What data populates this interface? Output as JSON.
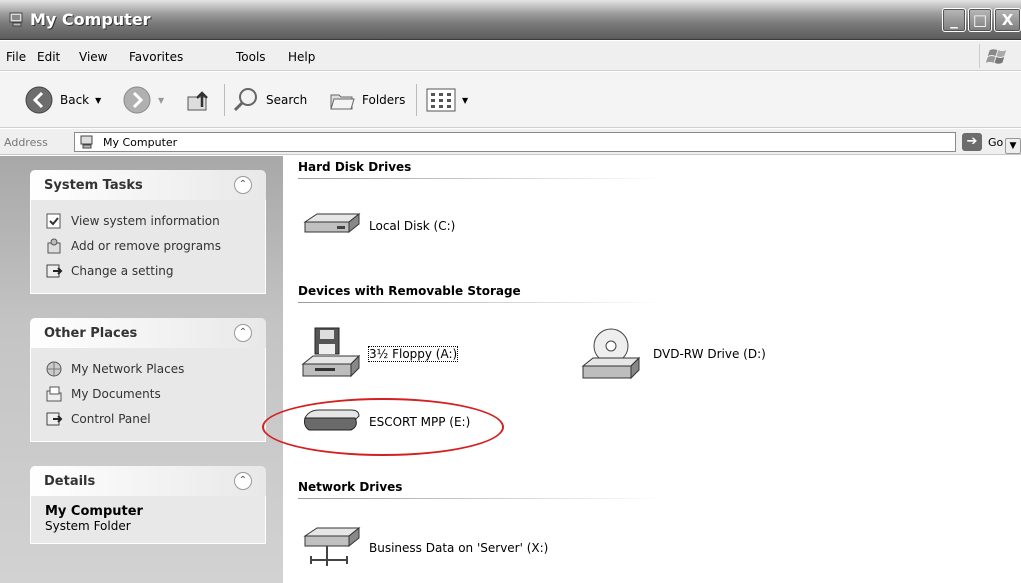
{
  "window": {
    "title": "My Computer",
    "buttons": {
      "minimize": "_",
      "maximize": "□",
      "close": "X"
    }
  },
  "menu": [
    "File",
    "Edit",
    "View",
    "Favorites",
    "Tools",
    "Help"
  ],
  "toolbar": {
    "back": "Back",
    "search": "Search",
    "folders": "Folders"
  },
  "address": {
    "label": "Address",
    "value": "My Computer",
    "go": "Go"
  },
  "sidebar": {
    "system_tasks": {
      "title": "System Tasks",
      "items": [
        "View system information",
        "Add or remove programs",
        "Change a setting"
      ]
    },
    "other_places": {
      "title": "Other Places",
      "items": [
        "My Network Places",
        "My Documents",
        "Control Panel"
      ]
    },
    "details": {
      "title": "Details",
      "name": "My Computer",
      "type": "System Folder"
    }
  },
  "groups": {
    "hard_disk": {
      "title": "Hard Disk Drives",
      "items": [
        "Local Disk (C:)"
      ]
    },
    "removable": {
      "title": "Devices with Removable Storage",
      "items": [
        "3½ Floppy (A:)",
        "DVD-RW Drive (D:)",
        "ESCORT MPP (E:)"
      ]
    },
    "network": {
      "title": "Network Drives",
      "items": [
        "Business Data on 'Server' (X:)"
      ]
    }
  },
  "colors": {
    "highlight_ellipse": "#d42020"
  }
}
